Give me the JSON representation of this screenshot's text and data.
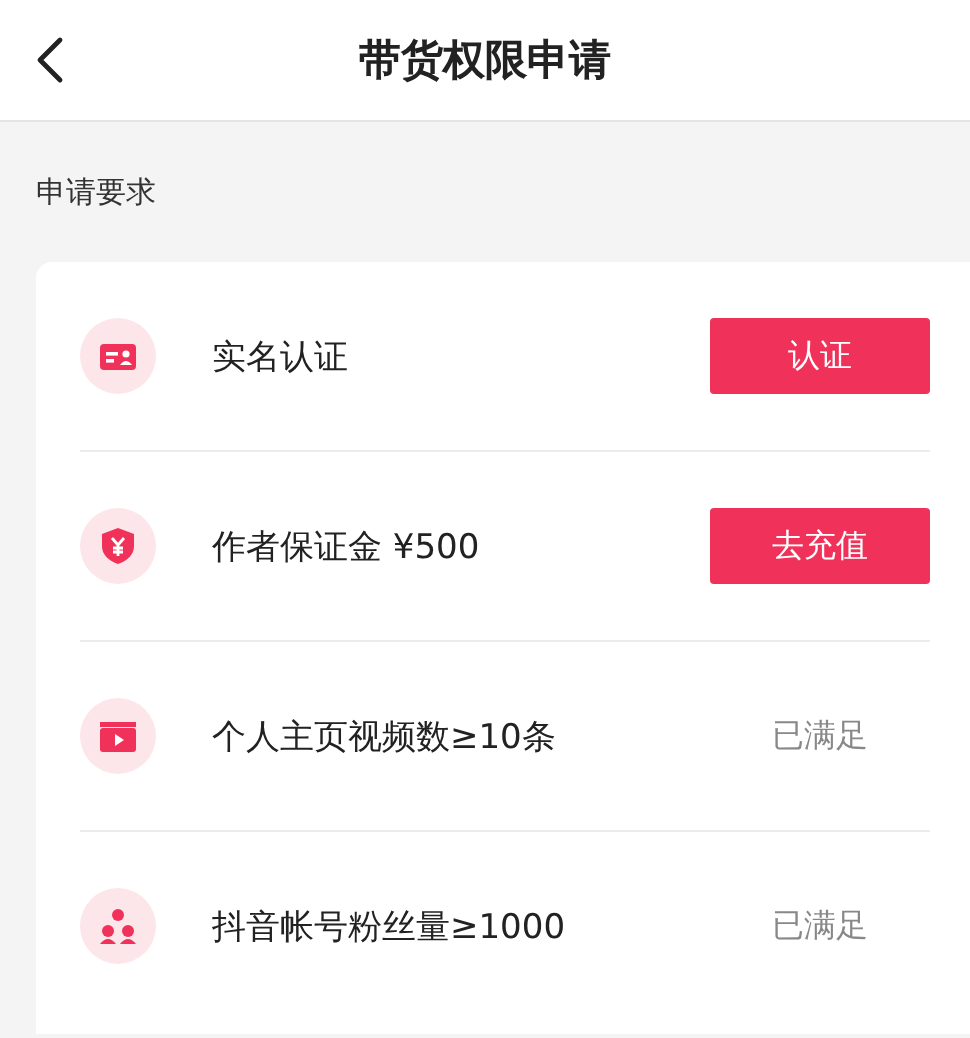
{
  "header": {
    "title": "带货权限申请"
  },
  "section": {
    "title": "申请要求"
  },
  "requirements": [
    {
      "label": "实名认证",
      "kind": "button",
      "action": "认证"
    },
    {
      "label": "作者保证金 ¥500",
      "kind": "button",
      "action": "去充值"
    },
    {
      "label": "个人主页视频数≥10条",
      "kind": "status",
      "action": "已满足"
    },
    {
      "label": "抖音帐号粉丝量≥1000",
      "kind": "status",
      "action": "已满足"
    }
  ]
}
